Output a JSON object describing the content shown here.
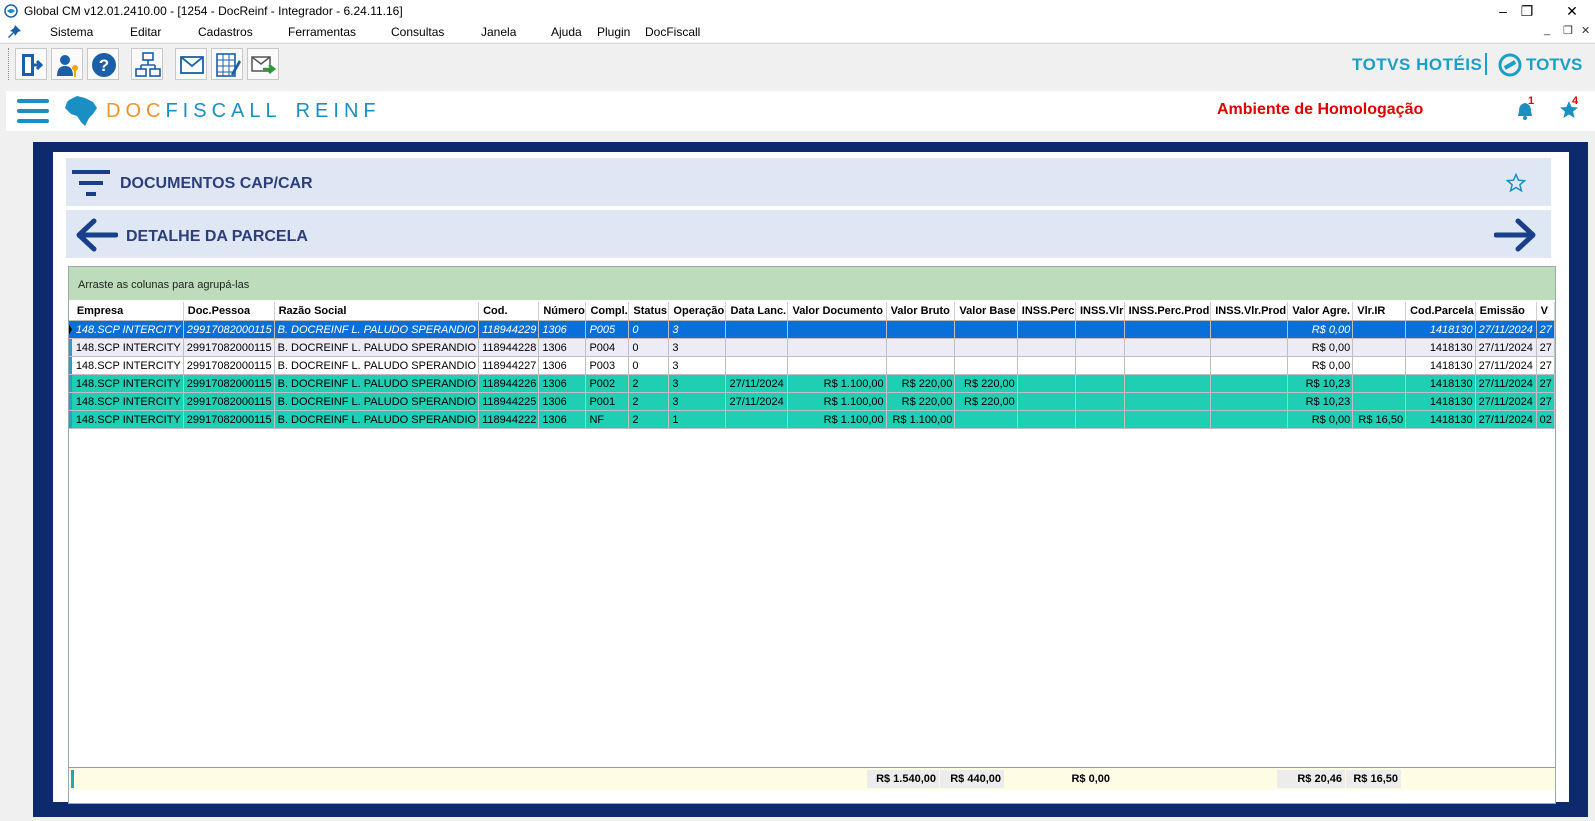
{
  "window": {
    "title": "Global CM v12.01.2410.00 - [1254 - DocReinf - Integrador - 6.24.11.16]",
    "controls": [
      "–",
      "❐",
      "✕"
    ]
  },
  "menu": {
    "items": [
      "Sistema",
      "Editar",
      "Cadastros",
      "Ferramentas",
      "Consultas",
      "Janela",
      "Ajuda",
      "Plugin",
      "DocFiscall"
    ],
    "mdi_controls": [
      "_",
      "❐",
      "✕"
    ]
  },
  "toolbar": {
    "buttons": [
      "exit-icon",
      "user-key-icon",
      "help-icon",
      "org-chart-icon",
      "mail-inbox-icon",
      "spreadsheet-edit-icon",
      "mail-send-icon"
    ]
  },
  "brand": {
    "totvs_hoteis": "TOTVS HOTÉIS",
    "totvs": "TOTVS",
    "accent": "#1a9fc6"
  },
  "app": {
    "name_doc": "DOC",
    "name_fiscall": "FISCALL",
    "name_reinf": "REINF",
    "ambiente": "Ambiente de Homologação",
    "bell_count": "1",
    "star_count": "4"
  },
  "panel": {
    "filter_title": "DOCUMENTOS CAP/CAR",
    "detail_title": "DETALHE DA PARCELA",
    "group_hint": "Arraste as colunas para agrupá-las"
  },
  "grid": {
    "columns": [
      "Empresa",
      "Doc.Pessoa",
      "Razão Social",
      "Cod.",
      "Número",
      "Compl.",
      "Status",
      "Operação",
      "Data Lanc.",
      "Valor Documento",
      "Valor Bruto",
      "Valor Base",
      "INSS.Perc",
      "INSS.Vlr",
      "INSS.Perc.Prod",
      "INSS.Vlr.Prod",
      "Valor Agre.",
      "Vlr.IR",
      "Cod.Parcela",
      "Emissão",
      "V"
    ],
    "rows": [
      [
        "148.SCP INTERCITY",
        "29917082000115",
        "B. DOCREINF  L. PALUDO SPERANDIO",
        "118944229",
        "1306",
        "P005",
        "0",
        "3",
        "",
        "",
        "",
        "",
        "",
        "",
        "",
        "",
        "R$ 0,00",
        "",
        "1418130",
        "27/11/2024",
        "27"
      ],
      [
        "148.SCP INTERCITY",
        "29917082000115",
        "B. DOCREINF  L. PALUDO SPERANDIO",
        "118944228",
        "1306",
        "P004",
        "0",
        "3",
        "",
        "",
        "",
        "",
        "",
        "",
        "",
        "",
        "R$ 0,00",
        "",
        "1418130",
        "27/11/2024",
        "27"
      ],
      [
        "148.SCP INTERCITY",
        "29917082000115",
        "B. DOCREINF  L. PALUDO SPERANDIO",
        "118944227",
        "1306",
        "P003",
        "0",
        "3",
        "",
        "",
        "",
        "",
        "",
        "",
        "",
        "",
        "R$ 0,00",
        "",
        "1418130",
        "27/11/2024",
        "27"
      ],
      [
        "148.SCP INTERCITY",
        "29917082000115",
        "B. DOCREINF  L. PALUDO SPERANDIO",
        "118944226",
        "1306",
        "P002",
        "2",
        "3",
        "27/11/2024",
        "R$ 1.100,00",
        "R$ 220,00",
        "R$ 220,00",
        "",
        "",
        "",
        "",
        "R$ 10,23",
        "",
        "1418130",
        "27/11/2024",
        "27"
      ],
      [
        "148.SCP INTERCITY",
        "29917082000115",
        "B. DOCREINF  L. PALUDO SPERANDIO",
        "118944225",
        "1306",
        "P001",
        "2",
        "3",
        "27/11/2024",
        "R$ 1.100,00",
        "R$ 220,00",
        "R$ 220,00",
        "",
        "",
        "",
        "",
        "R$ 10,23",
        "",
        "1418130",
        "27/11/2024",
        "27"
      ],
      [
        "148.SCP INTERCITY",
        "29917082000115",
        "B. DOCREINF  L. PALUDO SPERANDIO",
        "118944222",
        "1306",
        "NF",
        "2",
        "1",
        "",
        "R$ 1.100,00",
        "R$ 1.100,00",
        "",
        "",
        "",
        "",
        "",
        "R$ 0,00",
        "R$ 16,50",
        "1418130",
        "27/11/2024",
        "02"
      ]
    ],
    "row_styles": [
      "sel",
      "pale",
      "white",
      "teal",
      "teal",
      "teal"
    ],
    "numeric_columns": [
      9,
      10,
      11,
      16,
      17,
      18
    ],
    "totals": {
      "valor_bruto": "R$ 1.540,00",
      "valor_base": "R$ 440,00",
      "inss_vlr": "R$ 0,00",
      "valor_agre": "R$ 20,46",
      "vlr_ir": "R$ 16,50"
    },
    "colors": {
      "selected": "#0a6fd6",
      "teal": "#1fcfb4",
      "pale": "#ececf6"
    }
  }
}
